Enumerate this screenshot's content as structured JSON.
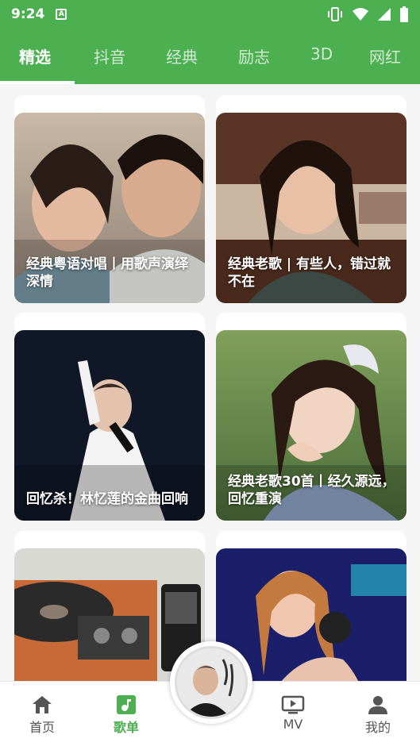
{
  "status": {
    "time": "9:24",
    "a_icon_letter": "A"
  },
  "tabs": [
    {
      "label": "精选"
    },
    {
      "label": "抖音"
    },
    {
      "label": "经典"
    },
    {
      "label": "励志"
    },
    {
      "label": "3D"
    },
    {
      "label": "网红"
    }
  ],
  "active_tab": "精选",
  "playlists": [
    {
      "title": "经典粤语对唱丨用歌声演绎深情"
    },
    {
      "title": "经典老歌 | 有些人，错过就不在"
    },
    {
      "title": "回忆杀！林忆莲的金曲回响"
    },
    {
      "title": "经典老歌30首丨经久源远，回忆重演"
    },
    {
      "title": ""
    },
    {
      "title": ""
    }
  ],
  "bottom_nav": [
    {
      "label": "首页",
      "icon": "home-icon"
    },
    {
      "label": "歌单",
      "icon": "music-note-icon"
    },
    {
      "label": "MV",
      "icon": "tv-icon"
    },
    {
      "label": "我的",
      "icon": "person-icon"
    }
  ],
  "colors": {
    "accent": "#4caf50"
  }
}
